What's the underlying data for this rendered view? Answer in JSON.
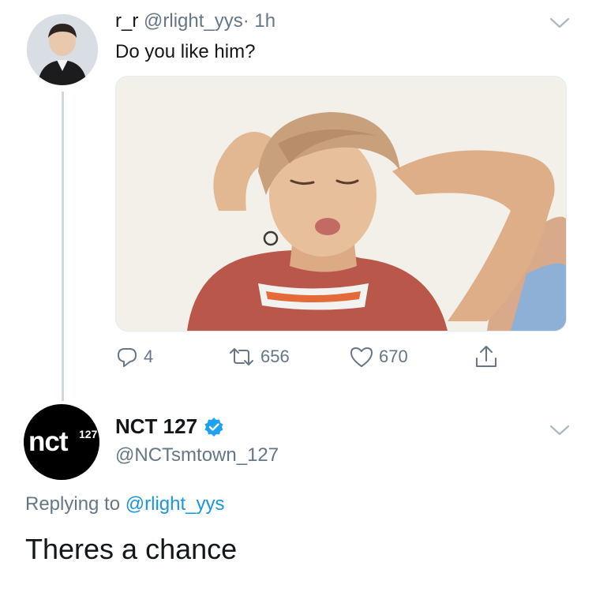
{
  "tweet1": {
    "display_name": "r_r",
    "handle": "@rlight_yys",
    "separator": "·",
    "time": "1h",
    "text": "Do you like him?",
    "actions": {
      "replies": "4",
      "retweets": "656",
      "likes": "670"
    }
  },
  "tweet2": {
    "avatar_logo": "nct",
    "avatar_logo_sup": "127",
    "display_name": "NCT 127",
    "handle": "@NCTsmtown_127",
    "replying_prefix": "Replying to",
    "replying_to": "@rlight_yys",
    "text": "Theres a chance"
  },
  "colors": {
    "muted": "#657786",
    "link": "#1b95e0",
    "thread_line": "#cfd9de",
    "verified": "#1da1f2"
  },
  "icons": [
    "chevron-down-icon",
    "reply-icon",
    "retweet-icon",
    "like-icon",
    "share-icon",
    "verified-icon"
  ]
}
